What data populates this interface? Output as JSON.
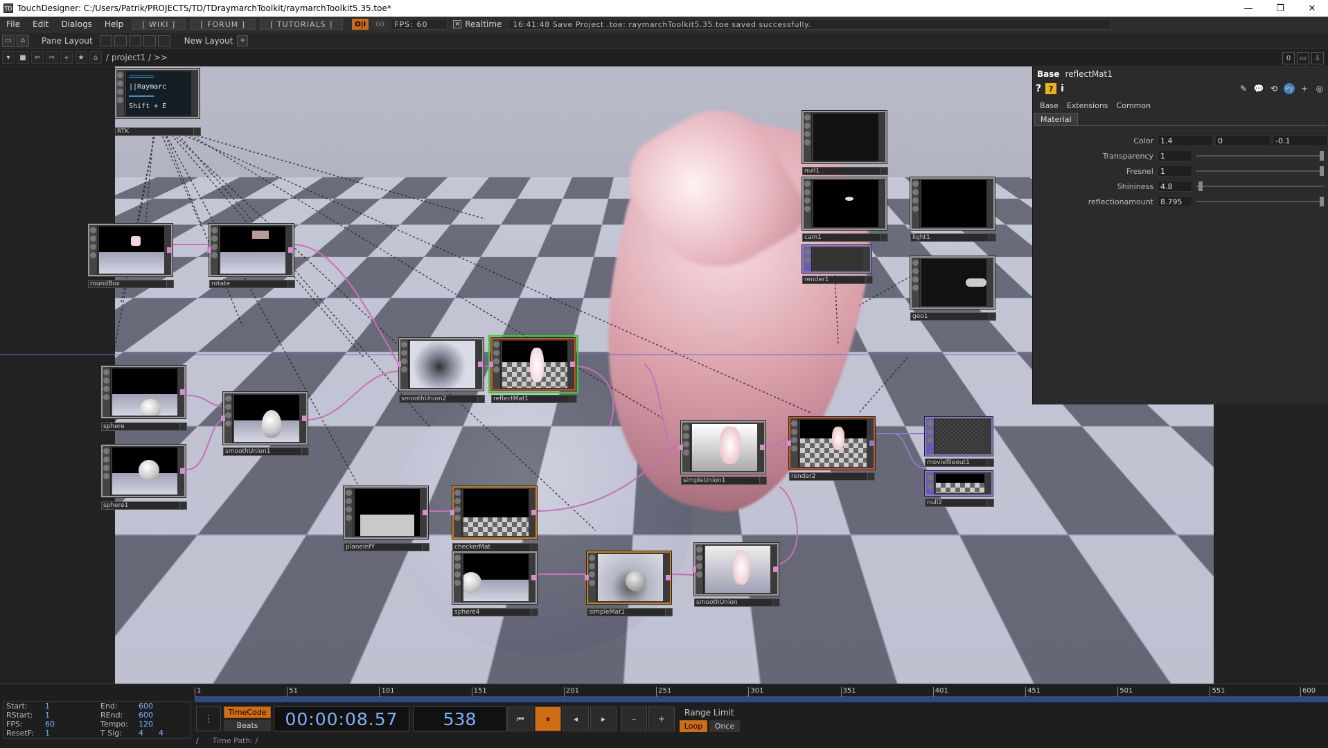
{
  "window": {
    "title": "TouchDesigner: C:/Users/Patrik/PROJECTS/TD/TDraymarchToolkit/raymarchToolkit5.35.toe*",
    "minimize": "—",
    "restore": "❐",
    "close": "✕"
  },
  "menu": {
    "items": [
      "File",
      "Edit",
      "Dialogs",
      "Help"
    ],
    "wiki": "[ WIKI ]",
    "forum": "[ FORUM ]",
    "tutorials": "[ TUTORIALS ]",
    "oi": "O|I",
    "fps_dim": "60",
    "fps_label": "FPS:  60",
    "realtime": "Realtime",
    "status": "16:41:48 Save Project .toe: raymarchToolkit5.35.toe saved successfully."
  },
  "pane": {
    "label": "Pane Layout",
    "new_layout": "New Layout",
    "add": "+"
  },
  "path": {
    "crumb": "/ project1 / >>",
    "right_val": "0"
  },
  "nodes": [
    {
      "name": "RTK",
      "text_lines": [
        "||Raymarc",
        "Shift + E"
      ]
    },
    {
      "name": "roundBox"
    },
    {
      "name": "rotate"
    },
    {
      "name": "sphere"
    },
    {
      "name": "smoothUnion1"
    },
    {
      "name": "sphere1"
    },
    {
      "name": "smoothUnion2"
    },
    {
      "name": "reflectMat1"
    },
    {
      "name": "planeInfY"
    },
    {
      "name": "checkerMat"
    },
    {
      "name": "sphere4"
    },
    {
      "name": "simpleMat1"
    },
    {
      "name": "smoothUnion"
    },
    {
      "name": "simpleUnion1"
    },
    {
      "name": "null1"
    },
    {
      "name": "cam1"
    },
    {
      "name": "light1"
    },
    {
      "name": "render1"
    },
    {
      "name": "geo1"
    },
    {
      "name": "render2"
    },
    {
      "name": "moviefileout1"
    },
    {
      "name": "null2"
    }
  ],
  "params": {
    "op_type": "Base",
    "op_name": "reflectMat1",
    "tabs": [
      "Base",
      "Extensions",
      "Common"
    ],
    "active_page": "Material",
    "rows": [
      {
        "label": "Color",
        "values": [
          "1.4",
          "0",
          "-0.1"
        ]
      },
      {
        "label": "Transparency",
        "value": "1",
        "slider": 1.0
      },
      {
        "label": "Fresnel",
        "value": "1",
        "slider": 1.0
      },
      {
        "label": "Shininess",
        "value": "4.8",
        "slider": 0.05
      },
      {
        "label": "reflectionamount",
        "value": "8.795",
        "slider": 1.0
      }
    ]
  },
  "timeline": {
    "ticks": [
      "1",
      "51",
      "101",
      "151",
      "201",
      "251",
      "301",
      "351",
      "401",
      "451",
      "501",
      "551",
      "600"
    ],
    "start_label": "Start:",
    "start": "1",
    "end_label": "End:",
    "end": "600",
    "rstart_label": "RStart:",
    "rstart": "1",
    "rend_label": "REnd:",
    "rend": "600",
    "fps_label": "FPS:",
    "fps": "60",
    "tempo_label": "Tempo:",
    "tempo": "120",
    "resetf_label": "ResetF:",
    "resetf": "1",
    "tsig_label": "T Sig:",
    "tsig1": "4",
    "tsig2": "4",
    "timecode_btn": "TimeCode",
    "beats_btn": "Beats",
    "timecode": "00:00:08.57",
    "frame": "538",
    "range_limit": "Range Limit",
    "loop": "Loop",
    "once": "Once",
    "time_path_label": "Time Path: /"
  }
}
